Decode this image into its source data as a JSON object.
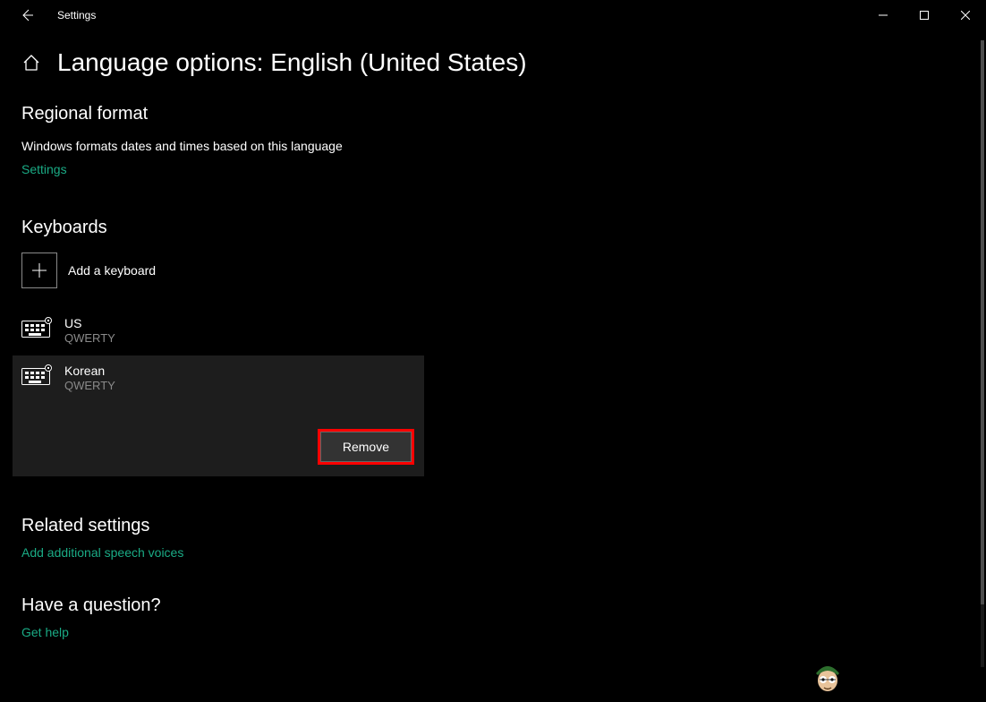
{
  "titlebar": {
    "title": "Settings"
  },
  "page": {
    "title": "Language options: English (United States)"
  },
  "regional": {
    "heading": "Regional format",
    "description": "Windows formats dates and times based on this language",
    "settings_link": "Settings"
  },
  "keyboards": {
    "heading": "Keyboards",
    "add_label": "Add a keyboard",
    "items": [
      {
        "name": "US",
        "layout": "QWERTY",
        "selected": false
      },
      {
        "name": "Korean",
        "layout": "QWERTY",
        "selected": true
      }
    ],
    "remove_label": "Remove"
  },
  "related": {
    "heading": "Related settings",
    "link": "Add additional speech voices"
  },
  "question": {
    "heading": "Have a question?",
    "link": "Get help"
  },
  "colors": {
    "accent": "#1aab85",
    "highlight_border": "#ff0000"
  }
}
